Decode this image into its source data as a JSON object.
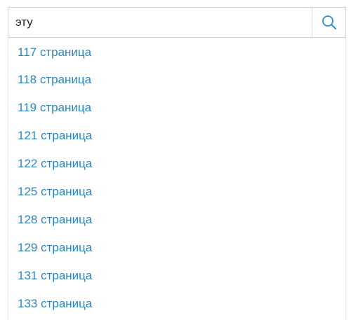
{
  "search": {
    "query": "эту",
    "button_icon": "search-icon"
  },
  "results": [
    {
      "label": "117 страница"
    },
    {
      "label": "118 страница"
    },
    {
      "label": "119 страница"
    },
    {
      "label": "121 страница"
    },
    {
      "label": "122 страница"
    },
    {
      "label": "125 страница"
    },
    {
      "label": "128 страница"
    },
    {
      "label": "129 страница"
    },
    {
      "label": "131 страница"
    },
    {
      "label": "133 страница"
    }
  ],
  "colors": {
    "link": "#2e86b6",
    "icon": "#2f8fc7",
    "border": "#c9d7e1"
  }
}
